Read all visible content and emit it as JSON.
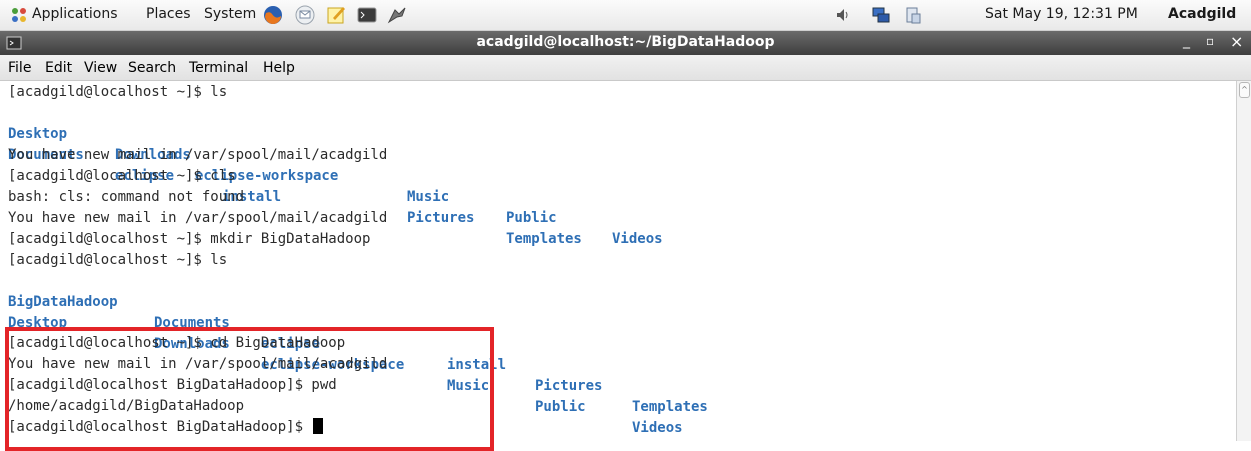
{
  "panel": {
    "menus": [
      "Applications",
      "Places",
      "System"
    ],
    "clock": "Sat May 19, 12:31 PM",
    "user": "Acadgild",
    "icons": [
      "applications-icon",
      "firefox-icon",
      "email-icon",
      "text-editor-icon",
      "terminal-icon",
      "screenshot-icon",
      "volume-icon",
      "network-icon",
      "clipboard-icon"
    ]
  },
  "window": {
    "title": "acadgild@localhost:~/BigDataHadoop",
    "controls": [
      "_",
      "▫",
      "×"
    ]
  },
  "menubar": [
    "File",
    "Edit",
    "View",
    "Search",
    "Terminal",
    "Help"
  ],
  "terminal": {
    "lines": [
      "[acadgild@localhost ~]$ ls",
      "",
      "",
      "You have new mail in /var/spool/mail/acadgild",
      "[acadgild@localhost ~]$ cls",
      "bash: cls: command not found",
      "You have new mail in /var/spool/mail/acadgild",
      "[acadgild@localhost ~]$ mkdir BigDataHadoop",
      "[acadgild@localhost ~]$ ls",
      "",
      "",
      "[acadgild@localhost ~]$ cd BigDataHadoop",
      "You have new mail in /var/spool/mail/acadgild",
      "[acadgild@localhost BigDataHadoop]$ pwd",
      "/home/acadgild/BigDataHadoop",
      "[acadgild@localhost BigDataHadoop]$ "
    ],
    "ls1_row1": [
      "Desktop",
      "Downloads",
      "eclipse-workspace",
      "Music",
      "Public",
      "Videos"
    ],
    "ls1_row2": [
      "Documents",
      "eclipse",
      "install",
      "Pictures",
      "Templates"
    ],
    "ls2_row1": [
      "BigDataHadoop",
      "Documents",
      "eclipse",
      "install",
      "Pictures",
      "Templates"
    ],
    "ls2_row2": [
      "Desktop",
      "Downloads",
      "eclipse-workspace",
      "Music",
      "Public",
      "Videos"
    ]
  },
  "colors": {
    "directory": "#2e6fb5",
    "highlight": "#e32428"
  }
}
